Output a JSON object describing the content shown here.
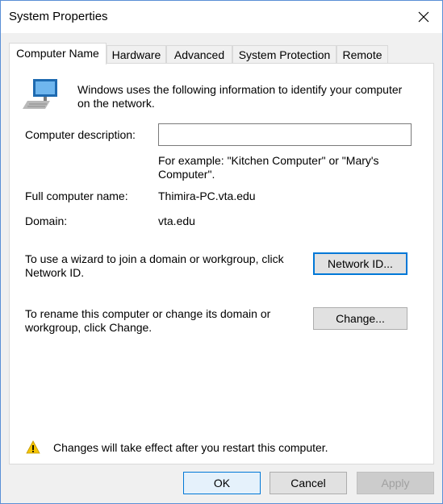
{
  "window": {
    "title": "System Properties"
  },
  "tabs": [
    {
      "label": "Computer Name",
      "active": true
    },
    {
      "label": "Hardware"
    },
    {
      "label": "Advanced"
    },
    {
      "label": "System Protection"
    },
    {
      "label": "Remote"
    }
  ],
  "intro": {
    "text": "Windows uses the following information to identify your computer on the network."
  },
  "description": {
    "label": "Computer description:",
    "value": "",
    "example": "For example: \"Kitchen Computer\" or \"Mary's Computer\"."
  },
  "full_name": {
    "label": "Full computer name:",
    "value": "Thimira-PC.vta.edu"
  },
  "domain": {
    "label": "Domain:",
    "value": "vta.edu"
  },
  "network_id": {
    "text": "To use a wizard to join a domain or workgroup, click Network ID.",
    "button": "Network ID..."
  },
  "rename": {
    "text": "To rename this computer or change its domain or workgroup, click Change.",
    "button": "Change..."
  },
  "warning": {
    "text": "Changes will take effect after you restart this computer."
  },
  "footer": {
    "ok": "OK",
    "cancel": "Cancel",
    "apply": "Apply"
  },
  "colors": {
    "accent": "#0078d7",
    "warning": "#f5c400"
  }
}
